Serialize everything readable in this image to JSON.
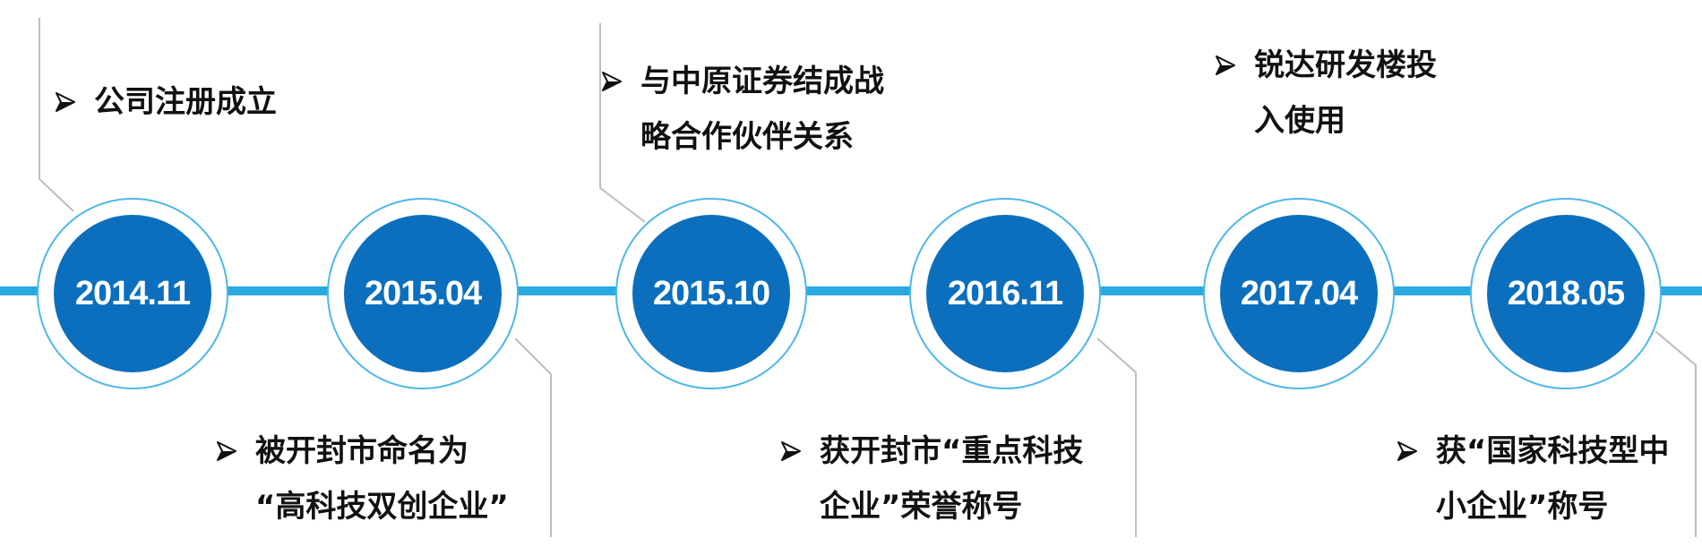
{
  "timeline": {
    "milestones": [
      {
        "date": "2014.11",
        "lines": [
          "公司注册成立"
        ],
        "side": "top"
      },
      {
        "date": "2015.04",
        "lines": [
          "被开封市命名为",
          "“高科技双创企业”"
        ],
        "side": "bottom"
      },
      {
        "date": "2015.10",
        "lines": [
          "与中原证券结成战",
          "略合作伙伴关系"
        ],
        "side": "top"
      },
      {
        "date": "2016.11",
        "lines": [
          "获开封市“重点科技",
          "企业”荣誉称号"
        ],
        "side": "bottom"
      },
      {
        "date": "2017.04",
        "lines": [
          "锐达研发楼投",
          "入使用"
        ],
        "side": "top"
      },
      {
        "date": "2018.05",
        "lines": [
          "获“国家科技型中",
          "小企业”称号"
        ],
        "side": "bottom"
      }
    ]
  },
  "colors": {
    "axis": "#29A9E0",
    "node_fill": "#0B6FBE",
    "node_ring": "#4DB7E9",
    "connector": "#BDBDBD",
    "text": "#111111"
  },
  "icons": {
    "bullet": "arrowhead-bullet-icon"
  }
}
